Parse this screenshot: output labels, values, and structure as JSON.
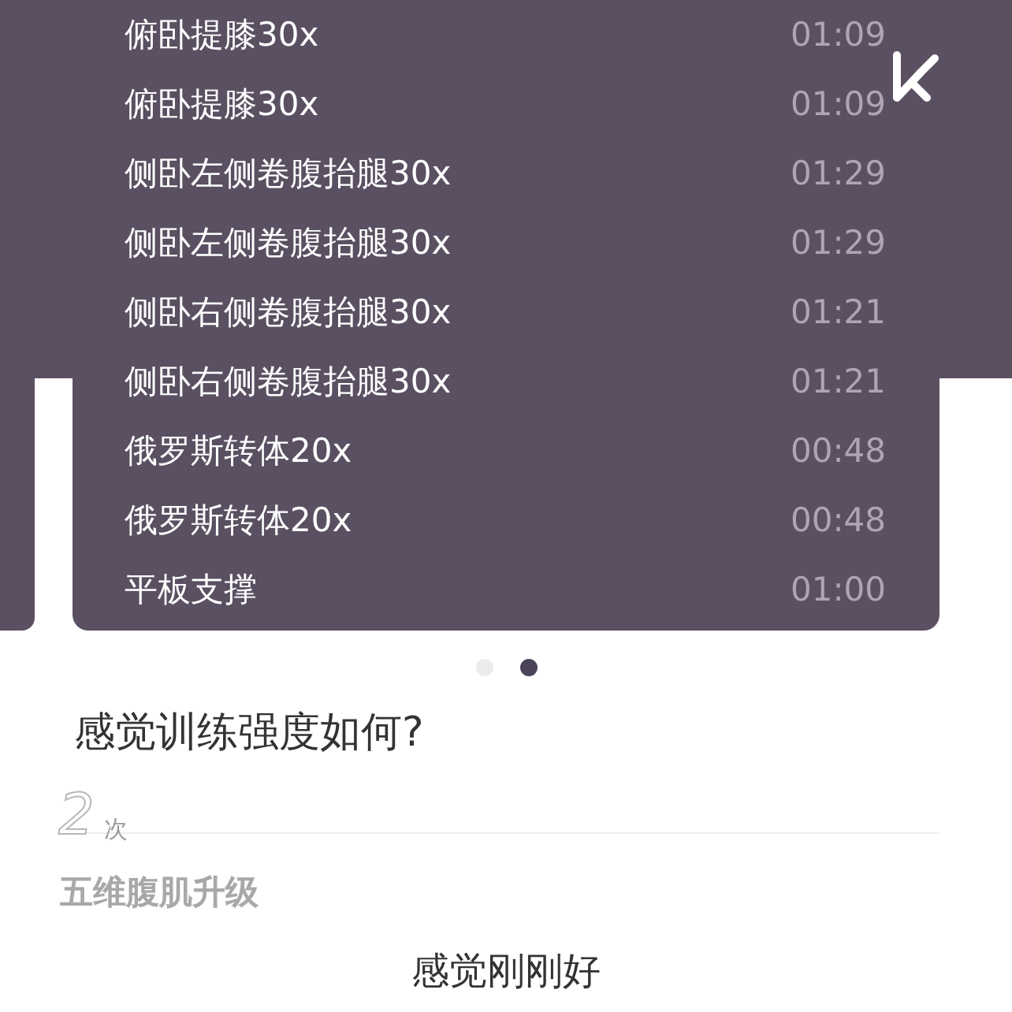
{
  "exercises": [
    {
      "name": "俯卧提膝30x",
      "duration": "01:09"
    },
    {
      "name": "俯卧提膝30x",
      "duration": "01:09"
    },
    {
      "name": "侧卧左侧卷腹抬腿30x",
      "duration": "01:29"
    },
    {
      "name": "侧卧左侧卷腹抬腿30x",
      "duration": "01:29"
    },
    {
      "name": "侧卧右侧卷腹抬腿30x",
      "duration": "01:21"
    },
    {
      "name": "侧卧右侧卷腹抬腿30x",
      "duration": "01:21"
    },
    {
      "name": "俄罗斯转体20x",
      "duration": "00:48"
    },
    {
      "name": "俄罗斯转体20x",
      "duration": "00:48"
    },
    {
      "name": "平板支撑",
      "duration": "01:00"
    }
  ],
  "pagination": [
    {
      "selected": false
    },
    {
      "selected": true
    }
  ],
  "question": "感觉训练强度如何?",
  "ghost": {
    "count": "2",
    "unit": "次",
    "title": "五维腹肌升级"
  },
  "answer": "感觉刚刚好"
}
